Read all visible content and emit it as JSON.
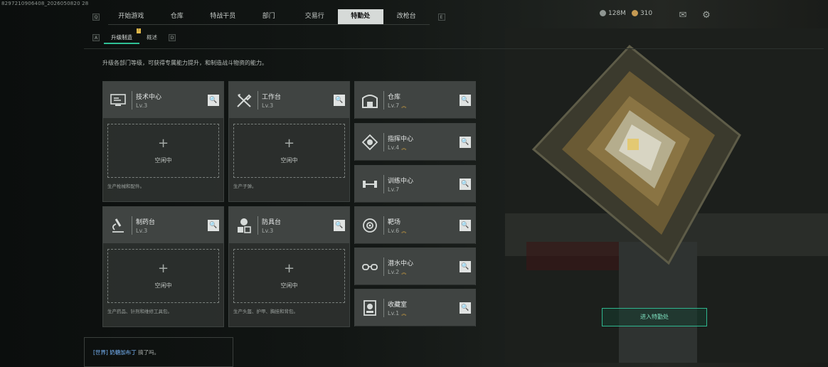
{
  "uid": "8297210906408_2026050820 28",
  "nav": {
    "left_key": "Q",
    "right_key": "E",
    "tabs": [
      "开始游戏",
      "仓库",
      "特战干员",
      "部门",
      "交易行",
      "特勤处",
      "改枪台"
    ],
    "active": "特勤处",
    "badge": "!"
  },
  "resources": {
    "money": "128M",
    "coins": "310"
  },
  "subtabs": {
    "left_key": "A",
    "right_key": "D",
    "items": [
      "升级制造",
      "概述"
    ],
    "active": "升级制造",
    "badge": "!"
  },
  "intro": "升级各部门等级，可获得专属能力提升，和制造战斗物资的能力。",
  "idle_label": "空闲中",
  "left_facilities": [
    {
      "name": "技术中心",
      "level": "Lv.3",
      "icon": "monitor-icon",
      "desc": "生产枪械和配件。"
    },
    {
      "name": "工作台",
      "level": "Lv.3",
      "icon": "tools-icon",
      "desc": "生产子弹。"
    },
    {
      "name": "制药台",
      "level": "Lv.3",
      "icon": "microscope-icon",
      "desc": "生产药品、针剂和维修工具包。"
    },
    {
      "name": "防具台",
      "level": "Lv.3",
      "icon": "armor-icon",
      "desc": "生产头盔、护甲、胸挂和背包。"
    }
  ],
  "right_facilities": [
    {
      "name": "仓库",
      "level": "Lv.7",
      "icon": "storage-icon",
      "upgrade": true
    },
    {
      "name": "指挥中心",
      "level": "Lv.4",
      "icon": "command-icon",
      "upgrade": true
    },
    {
      "name": "训练中心",
      "level": "Lv.7",
      "icon": "dumbbell-icon",
      "upgrade": false
    },
    {
      "name": "靶场",
      "level": "Lv.6",
      "icon": "target-icon",
      "upgrade": true
    },
    {
      "name": "潜水中心",
      "level": "Lv.2",
      "icon": "goggles-icon",
      "upgrade": true
    },
    {
      "name": "收藏室",
      "level": "Lv.1",
      "icon": "collection-icon",
      "upgrade": true
    }
  ],
  "enter_button": "进入特勤处",
  "chat": {
    "channel": "[世界]",
    "user": "奶糖加布丁",
    "message": "搞了吗。"
  }
}
